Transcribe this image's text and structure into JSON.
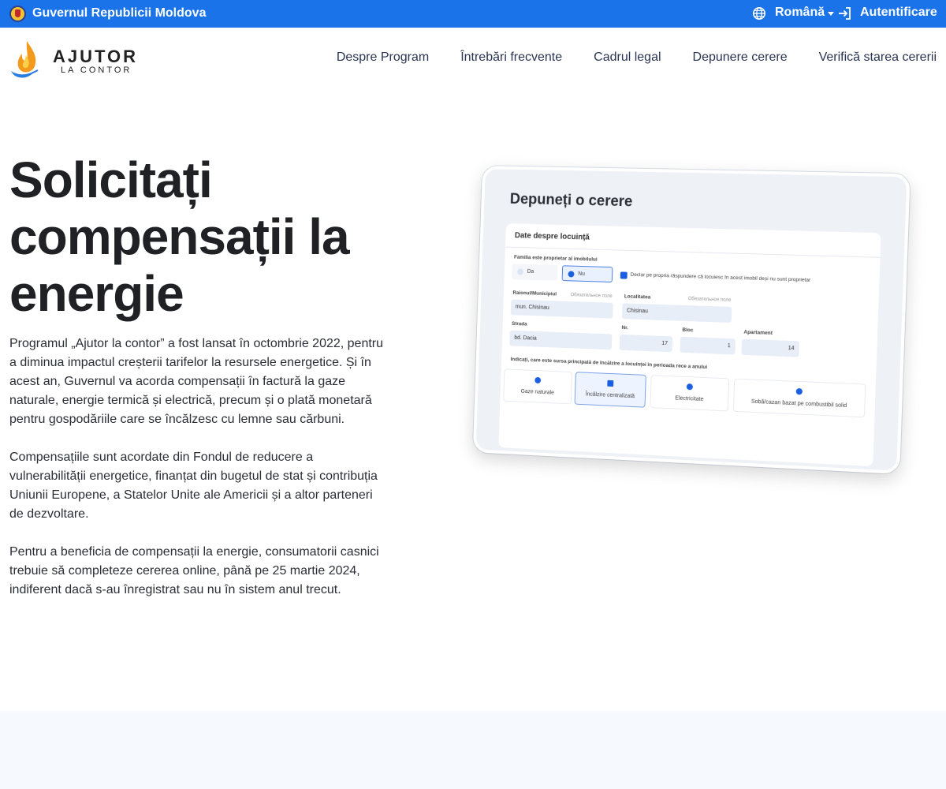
{
  "gov_bar": {
    "title": "Guvernul Republicii Moldova",
    "language": "Română",
    "login": "Autentificare",
    "background": "#1a73e8"
  },
  "logo": {
    "main": "AJUTOR",
    "sub": "LA CONTOR"
  },
  "nav": [
    {
      "label": "Despre Program"
    },
    {
      "label": "Întrebări frecvente"
    },
    {
      "label": "Cadrul legal"
    },
    {
      "label": "Depunere cerere"
    },
    {
      "label": "Verifică starea cererii"
    }
  ],
  "hero": {
    "title": "Solicitați compensații la energie",
    "paragraphs": [
      "Programul „Ajutor la contor” a fost lansat în octombrie 2022, pentru a diminua impactul creșterii tarifelor la resursele energetice. Și în acest an, Guvernul va acorda compensații în factură la gaze naturale, energie termică și electrică, precum și o plată monetară pentru gospodăriile care se încălzesc cu lemne sau cărbuni.",
      "Compensațiile sunt acordate din Fondul de reducere a vulnerabilității energetice, finanțat din bugetul de stat și contribuția Uniunii Europene, a Statelor Unite ale Americii și a altor parteneri de dezvoltare.",
      "Pentru a beneficia de compensații la energie, consumatorii casnici trebuie să completeze cererea online, până pe 25 martie 2024, indiferent dacă s-au înregistrat sau nu în sistem anul trecut."
    ]
  },
  "mockup": {
    "title": "Depuneți o cerere",
    "section": "Date despre locuință",
    "owner_label": "Familia este proprietar al imobilului",
    "owner_yes": "Da",
    "owner_no": "Nu",
    "declaration": "Declar pe propria răspundere că locuiesc în acest imobil deși nu sunt proprietar",
    "district_label": "Raionul/Municipiul",
    "required_hint": "Обязательное поле",
    "district_value": "mun. Chisinau",
    "locality_label": "Localitatea",
    "locality_value": "Chisinau",
    "street_label": "Strada",
    "street_value": "bd. Dacia",
    "nr_label": "Nr.",
    "nr_value": "17",
    "bloc_label": "Bloc",
    "bloc_value": "1",
    "apt_label": "Apartament",
    "apt_value": "14",
    "heating_question": "Indicați, care este sursa principală de încălzire a locuinței în perioada rece a anului",
    "heating_options": [
      "Gaze naturale",
      "Încălzire centralizată",
      "Electricitate",
      "Sobă/cazan bazat pe combustibil solid"
    ]
  }
}
